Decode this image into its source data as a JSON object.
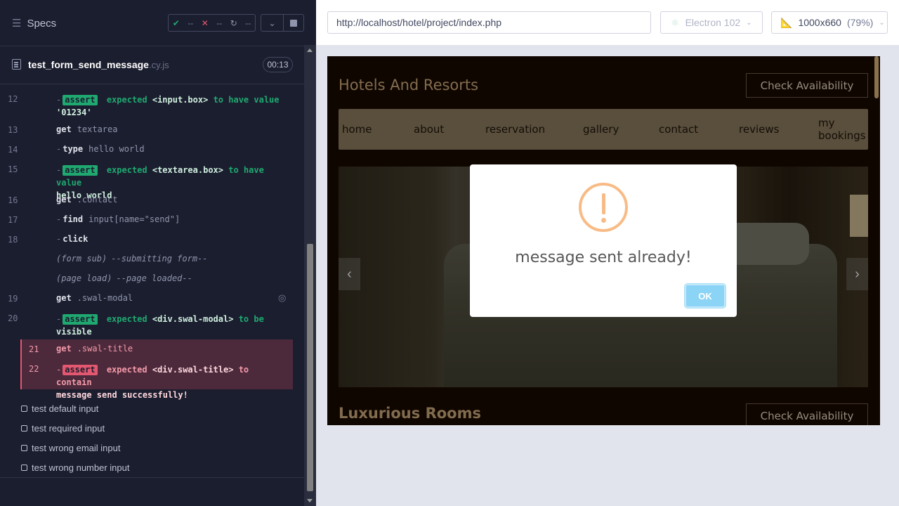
{
  "sidebar": {
    "title": "Specs",
    "status": {
      "passed": "--",
      "failed": "--",
      "pending": "--"
    },
    "file": {
      "name": "test_form_send_message",
      "ext": ".cy.js",
      "duration": "00:13"
    }
  },
  "log": {
    "l12": {
      "num": "12",
      "badge": "assert",
      "text": "expected",
      "a": "<input.box>",
      "b": "to have value",
      "c": "'01234'"
    },
    "l13": {
      "num": "13",
      "cmd": "get",
      "arg": "textarea"
    },
    "l14": {
      "num": "14",
      "cmd": "type",
      "arg": "hello world"
    },
    "l15": {
      "num": "15",
      "badge": "assert",
      "text": "expected",
      "a": "<textarea.box>",
      "b": "to have value",
      "c": "hello world"
    },
    "l16": {
      "num": "16",
      "cmd": "get",
      "arg": ".contact"
    },
    "l17": {
      "num": "17",
      "cmd": "find",
      "arg": "input[name=\"send\"]"
    },
    "l18": {
      "num": "18",
      "cmd": "click"
    },
    "form": {
      "label": "(form sub)",
      "text": "--submitting form--"
    },
    "page": {
      "label": "(page load)",
      "text": "--page loaded--"
    },
    "l19": {
      "num": "19",
      "cmd": "get",
      "arg": ".swal-modal"
    },
    "l20": {
      "num": "20",
      "badge": "assert",
      "text": "expected",
      "a": "<div.swal-modal>",
      "b": "to be",
      "c": "visible"
    },
    "l21": {
      "num": "21",
      "cmd": "get",
      "arg": ".swal-title"
    },
    "l22": {
      "num": "22",
      "badge": "assert",
      "text": "expected",
      "a": "<div.swal-title>",
      "b": "to contain",
      "c": "message send successfully!"
    }
  },
  "tests": [
    "test default input",
    "test required input",
    "test wrong email input",
    "test wrong number input"
  ],
  "browser_bar": {
    "url": "http://localhost/hotel/project/index.php",
    "browser": "Electron 102",
    "viewport": "1000x660",
    "zoom": "(79%)"
  },
  "aut": {
    "title": "Hotels And Resorts",
    "avail": "Check Availability",
    "nav": [
      "home",
      "about",
      "reservation",
      "gallery",
      "contact",
      "reviews",
      "my",
      "bookings"
    ],
    "rooms": "Luxurious Rooms",
    "modal": {
      "title": "message sent already!",
      "ok": "OK"
    }
  },
  "colors": {
    "pass": "#1fa971",
    "fail": "#e45770",
    "warning": "#f8bb86",
    "ok_button": "#8cd4f5"
  }
}
